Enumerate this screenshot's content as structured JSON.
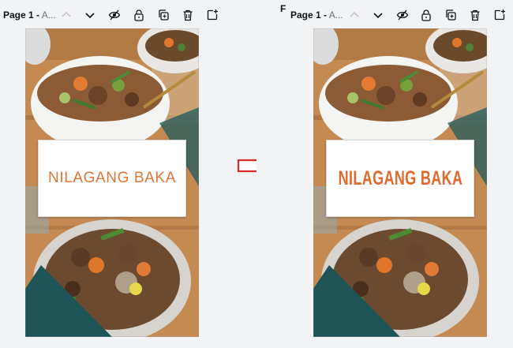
{
  "left": {
    "page_label_bold": "Page 1 -",
    "page_label_rest": " A...",
    "title_text": "NILAGANG BAKA"
  },
  "right": {
    "stray_char": "F",
    "page_label_bold": "Page 1 -",
    "page_label_rest": " A...",
    "title_text": "NILAGANG BAKA"
  },
  "icons": [
    "chevron-up-icon",
    "chevron-down-icon",
    "hide-icon",
    "lock-icon",
    "duplicate-icon",
    "trash-icon",
    "add-page-icon"
  ],
  "colors": {
    "title_orange": "#e37437",
    "arrow_red": "#d92d2d",
    "toolbar_text": "#0e1318"
  }
}
